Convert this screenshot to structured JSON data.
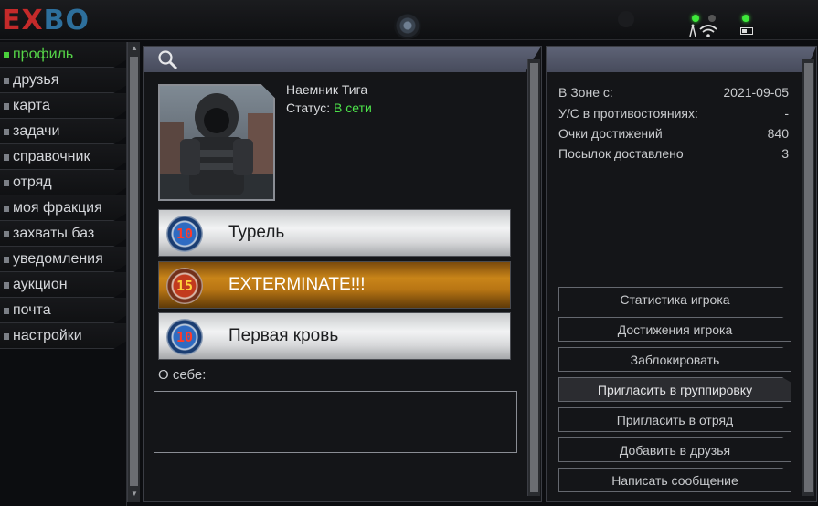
{
  "app": {
    "logo_left": "EX",
    "logo_right": "BO"
  },
  "sidebar": {
    "items": [
      {
        "label": "профиль",
        "active": true
      },
      {
        "label": "друзья"
      },
      {
        "label": "карта"
      },
      {
        "label": "задачи"
      },
      {
        "label": "справочник"
      },
      {
        "label": "отряд"
      },
      {
        "label": "моя фракция"
      },
      {
        "label": "захваты баз"
      },
      {
        "label": "уведомления"
      },
      {
        "label": "аукцион"
      },
      {
        "label": "почта"
      },
      {
        "label": "настройки"
      }
    ]
  },
  "profile": {
    "name": "Наемник Тига",
    "status_label": "Статус:",
    "status_value": "В сети",
    "status_color": "#4de34a",
    "about_label": "О себе:",
    "about_text": ""
  },
  "achievements": [
    {
      "badge": "10",
      "label": "Турель",
      "style": "white"
    },
    {
      "badge": "15",
      "label": "EXTERMINATE!!!",
      "style": "orange"
    },
    {
      "badge": "10",
      "label": "Первая кровь",
      "style": "white"
    }
  ],
  "stats": [
    {
      "label": "В Зоне с:",
      "value": "2021-09-05"
    },
    {
      "label": "У/С в противостояниях:",
      "value": "-"
    },
    {
      "label": "Очки достижений",
      "value": "840"
    },
    {
      "label": "Посылок доставлено",
      "value": "3"
    }
  ],
  "actions": [
    {
      "label": "Статистика игрока"
    },
    {
      "label": "Достижения игрока"
    },
    {
      "label": "Заблокировать"
    },
    {
      "label": "Пригласить в группировку",
      "highlight": true
    },
    {
      "label": "Пригласить в отряд"
    },
    {
      "label": "Добавить в друзья"
    },
    {
      "label": "Написать сообщение"
    }
  ],
  "icons": {
    "search": "search-icon",
    "wifi": "wifi-icon",
    "battery": "battery-icon"
  },
  "colors": {
    "accent_green": "#4ad03c",
    "header": "#5e6376",
    "logo_red": "#c42a2a",
    "logo_blue": "#2d6f9c"
  }
}
